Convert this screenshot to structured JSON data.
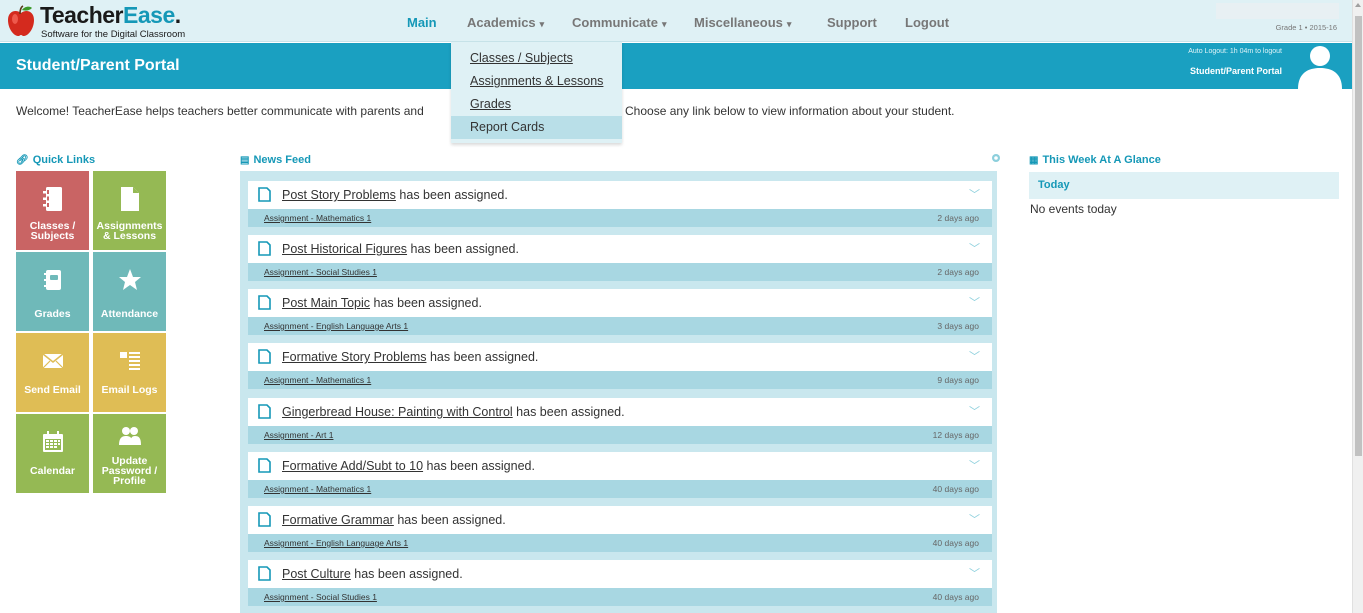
{
  "brand": {
    "name_part1": "Teacher",
    "name_part2": "Ease",
    "tagline": "Software for the Digital Classroom"
  },
  "nav": {
    "items": [
      {
        "label": "Main",
        "active": true,
        "has_caret": false
      },
      {
        "label": "Academics",
        "active": false,
        "has_caret": true
      },
      {
        "label": "Communicate",
        "active": false,
        "has_caret": true
      },
      {
        "label": "Miscellaneous",
        "active": false,
        "has_caret": true
      },
      {
        "label": "Support",
        "active": false,
        "has_caret": false
      },
      {
        "label": "Logout",
        "active": false,
        "has_caret": false
      }
    ],
    "grade_info": "Grade 1 • 2015-16"
  },
  "academics_menu": {
    "items": [
      "Classes / Subjects",
      "Assignments & Lessons",
      "Grades",
      "Report Cards"
    ],
    "highlighted": "Report Cards"
  },
  "portal": {
    "title": "Student/Parent Portal",
    "auto_logout": "Auto Logout: 1h 04m to logout",
    "right_title": "Student/Parent Portal"
  },
  "welcome": {
    "text_part1": "Welcome! TeacherEase helps teachers better communicate with parents and",
    "text_part2": "Choose any link below to view information about your student."
  },
  "quick_links": {
    "header": "Quick Links",
    "tiles": [
      {
        "label": "Classes / Subjects",
        "icon": "notebook-icon",
        "color": "#c96464"
      },
      {
        "label": "Assignments & Lessons",
        "icon": "document-icon",
        "color": "#95b954"
      },
      {
        "label": "Grades",
        "icon": "gradebook-icon",
        "color": "#6fb9b9"
      },
      {
        "label": "Attendance",
        "icon": "star-icon",
        "color": "#6fb9b9"
      },
      {
        "label": "Send Email",
        "icon": "envelope-icon",
        "color": "#dfbd55"
      },
      {
        "label": "Email Logs",
        "icon": "email-log-icon",
        "color": "#dfbd55"
      },
      {
        "label": "Calendar",
        "icon": "calendar-icon",
        "color": "#95b954"
      },
      {
        "label": "Update Password / Profile",
        "icon": "users-icon",
        "color": "#95b954"
      }
    ]
  },
  "news_feed": {
    "header": "News Feed",
    "items": [
      {
        "title": "Post Story Problems",
        "suffix": "has been assigned.",
        "category": "Assignment - Mathematics 1",
        "ago": "2 days ago"
      },
      {
        "title": "Post Historical Figures",
        "suffix": "has been assigned.",
        "category": "Assignment - Social Studies 1",
        "ago": "2 days ago"
      },
      {
        "title": "Post Main Topic",
        "suffix": "has been assigned.",
        "category": "Assignment - English Language Arts 1",
        "ago": "3 days ago"
      },
      {
        "title": "Formative Story Problems",
        "suffix": "has been assigned.",
        "category": "Assignment - Mathematics 1",
        "ago": "9 days ago"
      },
      {
        "title": "Gingerbread House: Painting with Control",
        "suffix": "has been assigned.",
        "category": "Assignment - Art 1",
        "ago": "12 days ago"
      },
      {
        "title": "Formative Add/Subt to 10",
        "suffix": "has been assigned.",
        "category": "Assignment - Mathematics 1",
        "ago": "40 days ago"
      },
      {
        "title": "Formative Grammar",
        "suffix": "has been assigned.",
        "category": "Assignment - English Language Arts 1",
        "ago": "40 days ago"
      },
      {
        "title": "Post Culture",
        "suffix": "has been assigned.",
        "category": "Assignment - Social Studies 1",
        "ago": "40 days ago"
      }
    ]
  },
  "week": {
    "header": "This Week At A Glance",
    "day_label": "Today",
    "empty_text": "No events today"
  },
  "colors": {
    "accent": "#1598b7",
    "portal_bar": "#1aa0c1",
    "nav_bg": "#dff1f5"
  }
}
